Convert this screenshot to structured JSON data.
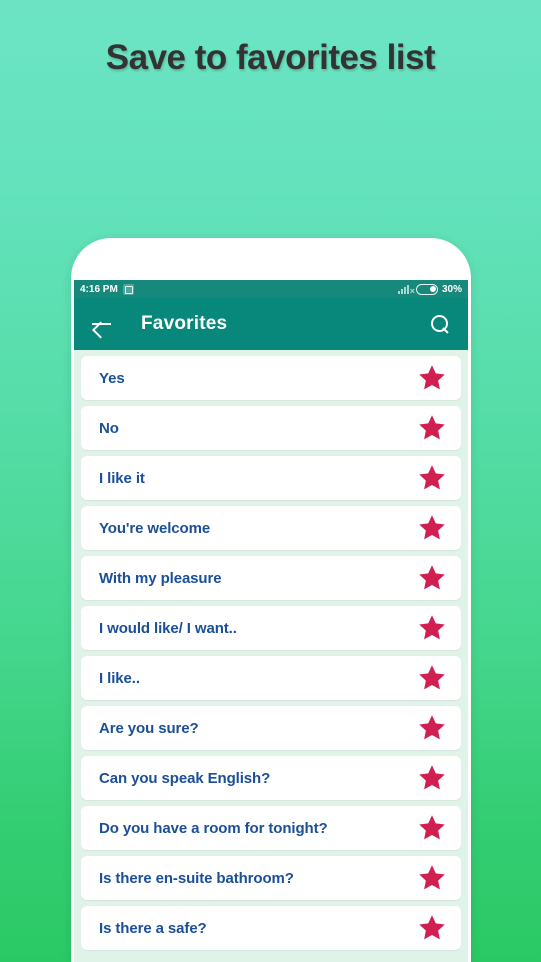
{
  "headline": "Save to favorites list",
  "colors": {
    "bg_top": "#6ce4c4",
    "bg_bottom": "#2bc965",
    "appbar": "#07887a",
    "statusbar": "#17897c",
    "item_text": "#1b4f97",
    "star": "#d2records"
  },
  "statusbar": {
    "time": "4:16 PM",
    "notification_icon": "app-notification-icon",
    "signal_icon": "signal-bars-no-service-icon",
    "battery_icon": "battery-icon",
    "battery_percent": "30%"
  },
  "appbar": {
    "back_icon": "back-arrow-icon",
    "title": "Favorites",
    "search_icon": "search-icon"
  },
  "list": {
    "star_icon": "star-filled-icon",
    "items": [
      {
        "label": "Yes",
        "favorited": true
      },
      {
        "label": "No",
        "favorited": true
      },
      {
        "label": "I like it",
        "favorited": true
      },
      {
        "label": "You're welcome",
        "favorited": true
      },
      {
        "label": "With my pleasure",
        "favorited": true
      },
      {
        "label": "I would like/ I want..",
        "favorited": true
      },
      {
        "label": "I like..",
        "favorited": true
      },
      {
        "label": "Are you sure?",
        "favorited": true
      },
      {
        "label": "Can you speak English?",
        "favorited": true
      },
      {
        "label": "Do you have a room for tonight?",
        "favorited": true
      },
      {
        "label": "Is there en-suite bathroom?",
        "favorited": true
      },
      {
        "label": "Is there a safe?",
        "favorited": true
      }
    ]
  }
}
